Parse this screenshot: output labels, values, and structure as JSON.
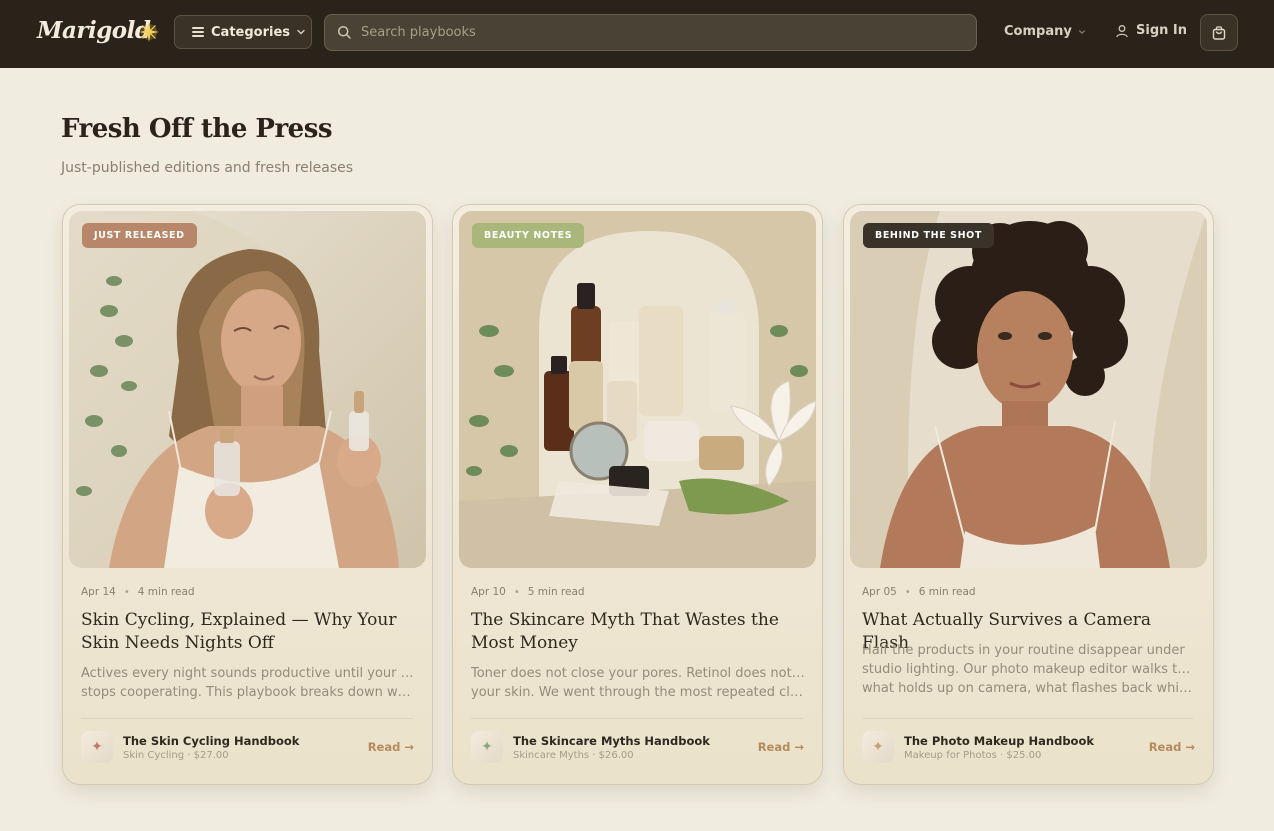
{
  "header": {
    "logo": "Marigold",
    "categories_label": "Categories",
    "search_placeholder": "Search playbooks",
    "company_label": "Company",
    "signin_label": "Sign In"
  },
  "section": {
    "title": "Fresh Off the Press",
    "subtitle": "Just-published editions and fresh releases"
  },
  "cards": [
    {
      "badge": "JUST RELEASED",
      "badge_color": "#b8876a",
      "date": "Apr 14",
      "read_time": "4 min read",
      "title": "Skin Cycling, Explained — Why Your Skin Needs Nights Off",
      "excerpt": [
        "Actives every night sounds productive until your skin",
        "stops cooperating. This playbook breaks down which..."
      ],
      "product_name": "The Skin Cycling Handbook",
      "product_meta": "Skin Cycling · $27.00",
      "icon_color": "#c07a6a",
      "cta": "Read →"
    },
    {
      "badge": "BEAUTY NOTES",
      "badge_color": "#a9b87a",
      "date": "Apr 10",
      "read_time": "5 min read",
      "title": "The Skincare Myth That Wastes the Most Money",
      "excerpt": [
        "Toner does not close your pores. Retinol does not thin",
        "your skin. We went through the most repeated claims i..."
      ],
      "product_name": "The Skincare Myths Handbook",
      "product_meta": "Skincare Myths · $26.00",
      "icon_color": "#8aab7a",
      "cta": "Read →"
    },
    {
      "badge": "BEHIND THE SHOT",
      "badge_color": "#3a332a",
      "date": "Apr 05",
      "read_time": "6 min read",
      "title": "What Actually Survives a Camera Flash",
      "excerpt": [
        "Half the products in your routine disappear under",
        "studio lighting. Our photo makeup editor walks through...",
        "what holds up on camera, what flashes back white, and"
      ],
      "product_name": "The Photo Makeup Handbook",
      "product_meta": "Makeup for Photos · $25.00",
      "icon_color": "#c9a070",
      "cta": "Read →"
    }
  ]
}
